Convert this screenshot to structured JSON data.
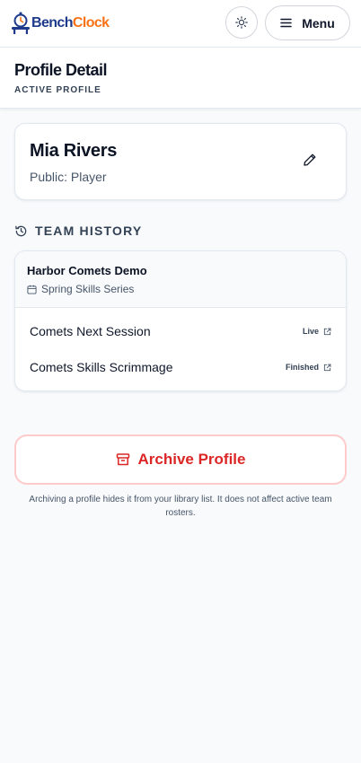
{
  "app": {
    "logo_part1": "Bench",
    "logo_part2": "Clock",
    "menu_label": "Menu",
    "brand_color": "#1e3a8a",
    "accent_color": "#f97316"
  },
  "page": {
    "title": "Profile Detail",
    "subtitle": "ACTIVE PROFILE"
  },
  "profile": {
    "name": "Mia Rivers",
    "role": "Public: Player"
  },
  "team_history": {
    "heading": "TEAM HISTORY",
    "team": {
      "name": "Harbor Comets Demo",
      "series": "Spring Skills Series"
    },
    "sessions": [
      {
        "name": "Comets Next Session",
        "status": "Live"
      },
      {
        "name": "Comets Skills Scrimmage",
        "status": "Finished"
      }
    ]
  },
  "archive": {
    "label": "Archive Profile",
    "note": "Archiving a profile hides it from your library list. It does not affect active team rosters.",
    "color": "#dc2626"
  },
  "icons": {
    "logo": "bench-clock-logo-icon",
    "theme": "sun-icon",
    "menu": "hamburger-icon",
    "edit": "pencil-icon",
    "history": "history-icon",
    "calendar": "calendar-icon",
    "external": "external-link-icon",
    "archive": "archive-icon"
  }
}
